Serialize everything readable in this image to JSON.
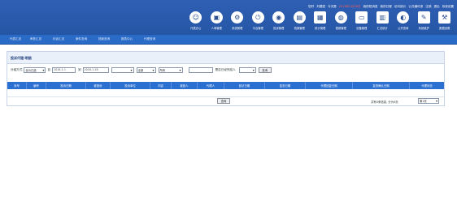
{
  "toplinks": [
    "您好",
    "刘德斌",
    "今天是",
    "2016年1月28日",
    "我的短消息",
    "我的日程",
    "访问统计",
    "公共通讯录",
    "注销",
    "退出",
    "系统设置"
  ],
  "icons": [
    {
      "name": "users-icon",
      "glyph": "☺",
      "label": "代表办公",
      "shape": "round"
    },
    {
      "name": "people-icon",
      "glyph": "▣",
      "label": "人事管理",
      "shape": "round"
    },
    {
      "name": "gear-icon",
      "glyph": "⚙",
      "label": "系统管理",
      "shape": "round"
    },
    {
      "name": "power-icon",
      "glyph": "⏻",
      "label": "平台管理",
      "shape": "round"
    },
    {
      "name": "alert-icon",
      "glyph": "◉",
      "label": "投诉管理",
      "shape": "round"
    },
    {
      "name": "book-icon",
      "glyph": "▤",
      "label": "档案管理",
      "shape": "round"
    },
    {
      "name": "report-icon",
      "glyph": "▦",
      "label": "统计管理",
      "shape": "sq"
    },
    {
      "name": "film-icon",
      "glyph": "◍",
      "label": "视频管理",
      "shape": "round"
    },
    {
      "name": "monitor-icon",
      "glyph": "▭",
      "label": "设备管理",
      "shape": "sq"
    },
    {
      "name": "chart-icon",
      "glyph": "▥",
      "label": "汇总统计",
      "shape": "sq"
    },
    {
      "name": "globe-icon",
      "glyph": "◐",
      "label": "公开查询",
      "shape": "round"
    },
    {
      "name": "tools-icon",
      "glyph": "✎",
      "label": "系统维护",
      "shape": "sq"
    },
    {
      "name": "settings-icon",
      "glyph": "⚒",
      "label": "数据设置",
      "shape": "sq"
    }
  ],
  "nav": [
    "代表汇总",
    "审批汇总",
    "约谈汇总",
    "案件查询",
    "档案查询",
    "报表中心",
    "代理查询"
  ],
  "panel": {
    "title": "投诉代理-明细"
  },
  "filters": {
    "label_type": "分组方式",
    "type_value": "全为已选",
    "label_from": "自",
    "date_from": "2016-1-1",
    "label_to": "到",
    "date_to": "2016-1-28",
    "unit_value": "",
    "status_value": "全部",
    "kind_value": "所有",
    "text_value": "",
    "label_owner": "是否已经完结人",
    "owner_value": "",
    "query_button": "查询"
  },
  "table": {
    "columns": [
      "序号",
      "编号",
      "投诉日期",
      "被投诉",
      "投诉单位",
      "内容",
      "被投人",
      "代理人",
      "回访日期",
      "复查日期",
      "代理回复日期",
      "复查确认日期",
      "代理状态"
    ]
  },
  "pager": {
    "button": "查询",
    "info": "共有0条信息, 分为0页",
    "page_select": "第1页"
  }
}
